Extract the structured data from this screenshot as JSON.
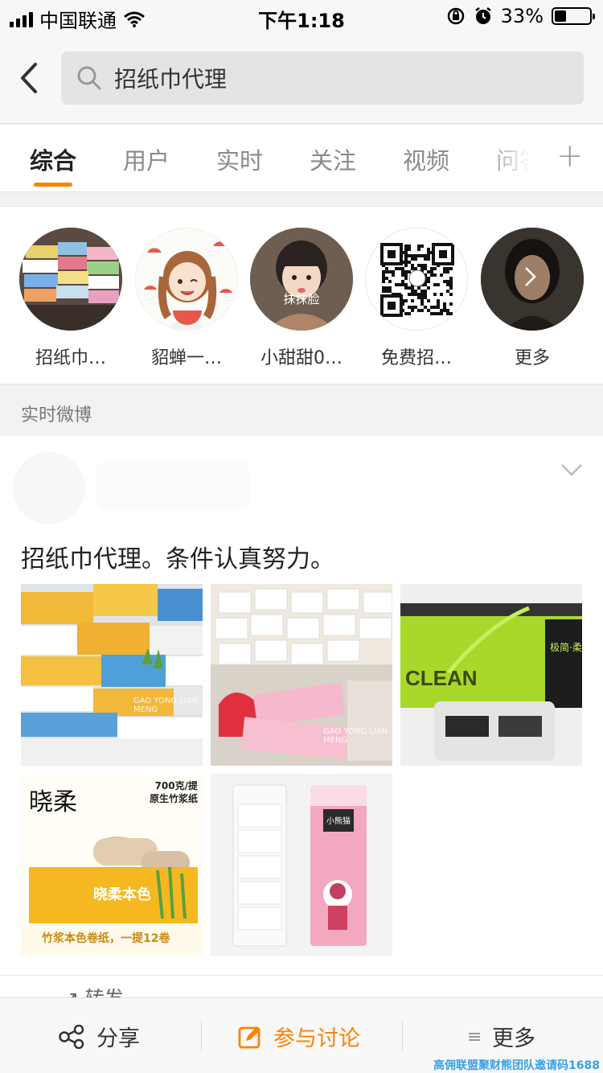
{
  "status_bar": {
    "carrier": "中国联通",
    "time": "下午1:18",
    "battery": "33%",
    "battery_level": 0.33
  },
  "search": {
    "query": "招纸巾代理"
  },
  "tabs": [
    {
      "label": "综合"
    },
    {
      "label": "用户"
    },
    {
      "label": "实时"
    },
    {
      "label": "关注"
    },
    {
      "label": "视频"
    },
    {
      "label": "问答"
    }
  ],
  "users": [
    {
      "name": "招纸巾…"
    },
    {
      "name": "貂蝉一…"
    },
    {
      "name": "小甜甜0…"
    },
    {
      "name": "免费招…"
    },
    {
      "name": "更多"
    }
  ],
  "avatar_overlay_text": "抹抹脸",
  "section_title": "实时微博",
  "post": {
    "text": "招纸巾代理。条件认真努力。",
    "images": [
      {
        "watermark": "GAO YONG LIAN MENG"
      },
      {
        "watermark": "GAO YONG LIAN MENG"
      },
      {
        "brand": "CLEAN",
        "sub": "极简·柔"
      },
      {
        "brand": "晓柔",
        "weight": "700克/提",
        "material": "原生竹浆纸",
        "pack": "晓柔本色",
        "caption": "竹浆本色卷纸，一提12卷"
      },
      {
        "label": "小熊猫"
      }
    ],
    "actions": {
      "repost": "转发"
    }
  },
  "bottom_bar": {
    "share": "分享",
    "discuss": "参与讨论",
    "more": "更多"
  },
  "corner_watermark": "高佣联盟聚财熊团队邀请码1688",
  "colors": {
    "accent": "#ff8200",
    "tab_active": "#222222",
    "tab_inactive": "#8a8a8a"
  }
}
